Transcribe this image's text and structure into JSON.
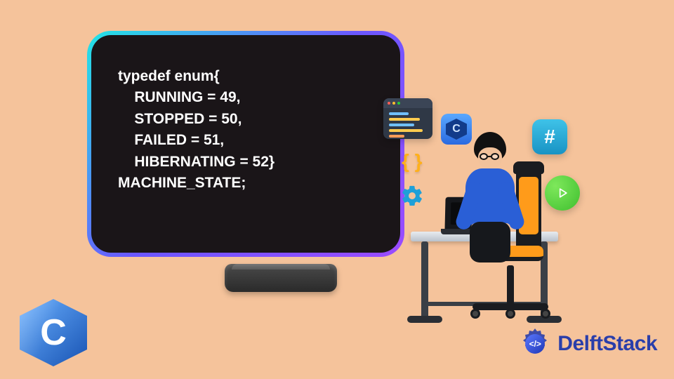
{
  "code": {
    "line1": "typedef enum{",
    "line2": "    RUNNING = 49,",
    "line3": "    STOPPED = 50,",
    "line4": "    FAILED = 51,",
    "line5": "    HIBERNATING = 52}",
    "line6": "MACHINE_STATE;"
  },
  "icons": {
    "c_badge_letter": "C",
    "hash_symbol": "#",
    "braces_symbol": "{ }",
    "c_logo_letter": "C"
  },
  "brand": {
    "name": "DelftStack",
    "logo_text": "</>"
  }
}
